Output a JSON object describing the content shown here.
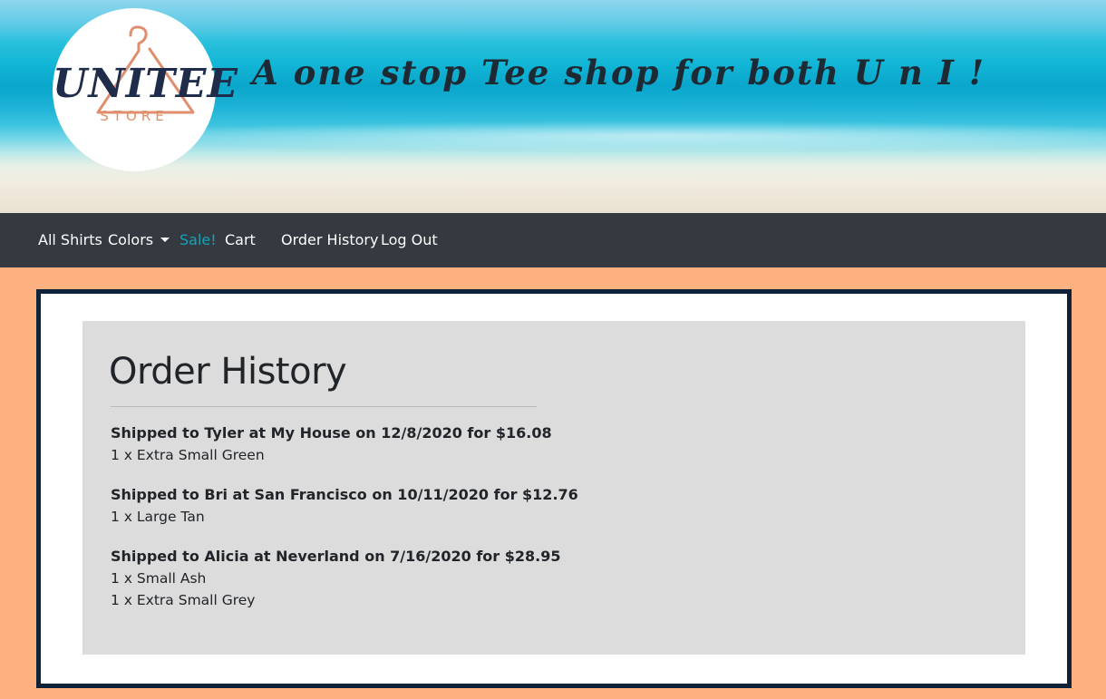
{
  "header": {
    "logo_word": "UNITEE",
    "logo_sub": "STORE",
    "tagline": "A one stop Tee shop for both U n I !"
  },
  "nav": {
    "all_shirts": "All Shirts",
    "colors": "Colors",
    "sale": "Sale!",
    "cart": "Cart",
    "order_history": "Order History",
    "log_out": "Log Out"
  },
  "colors": {
    "navbar_bg": "#343a40",
    "sale_link": "#17a2b8",
    "page_bg": "#fdb180",
    "frame_border": "#0e2238",
    "panel_bg": "#dcdcdc",
    "logo_navy": "#1f2d4a",
    "logo_coral": "#e08f6e"
  },
  "main": {
    "title": "Order History",
    "orders": [
      {
        "summary": "Shipped to Tyler at My House on 12/8/2020 for $16.08",
        "items": [
          "1 x Extra Small Green"
        ]
      },
      {
        "summary": "Shipped to Bri at San Francisco on 10/11/2020 for $12.76",
        "items": [
          "1 x Large Tan"
        ]
      },
      {
        "summary": "Shipped to Alicia at Neverland on 7/16/2020 for $28.95",
        "items": [
          "1 x Small Ash",
          "1 x Extra Small Grey"
        ]
      }
    ]
  }
}
